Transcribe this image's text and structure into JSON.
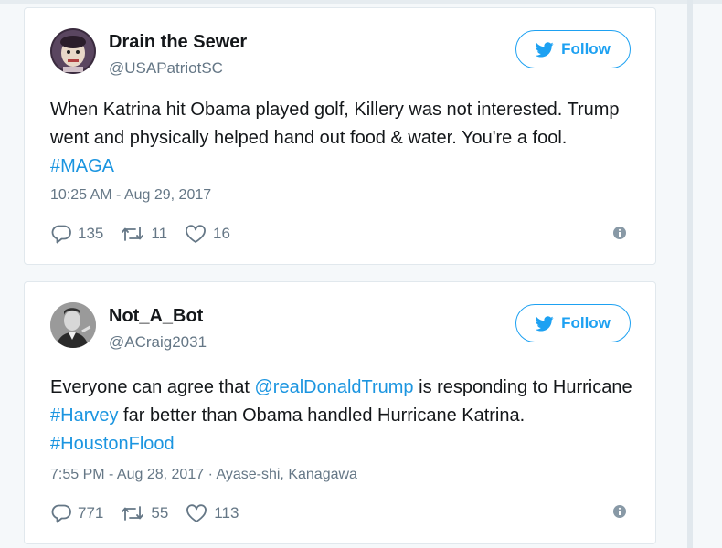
{
  "tweets": [
    {
      "name": "Drain the Sewer",
      "handle": "@USAPatriotSC",
      "follow_label": "Follow",
      "text_parts": [
        {
          "text": "When Katrina hit Obama played golf, Killery was not interested. Trump went and physically helped hand out food & water. You're a fool. ",
          "link": false
        },
        {
          "text": "#MAGA",
          "link": true
        }
      ],
      "timestamp": "10:25 AM - Aug 29, 2017",
      "location": "",
      "replies": "135",
      "retweets": "11",
      "likes": "16"
    },
    {
      "name": "Not_A_Bot",
      "handle": "@ACraig2031",
      "follow_label": "Follow",
      "text_parts": [
        {
          "text": "Everyone can agree that ",
          "link": false
        },
        {
          "text": "@realDonaldTrump",
          "link": true
        },
        {
          "text": " is responding to Hurricane ",
          "link": false
        },
        {
          "text": "#Harvey",
          "link": true
        },
        {
          "text": " far better than Obama handled Hurricane Katrina. ",
          "link": false
        },
        {
          "text": "#HoustonFlood",
          "link": true
        }
      ],
      "timestamp": "7:55 PM - Aug 28, 2017",
      "location": "Ayase-shi, Kanagawa",
      "replies": "771",
      "retweets": "55",
      "likes": "113"
    }
  ],
  "icons": {
    "follow": "twitter-bird-icon",
    "reply": "reply-icon",
    "retweet": "retweet-icon",
    "like": "heart-icon",
    "info": "info-icon"
  },
  "colors": {
    "accent": "#1da1f2",
    "link": "#1b95e0",
    "muted": "#657786",
    "text": "#14171a"
  }
}
